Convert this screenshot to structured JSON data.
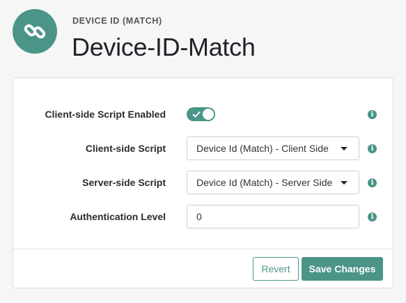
{
  "header": {
    "icon": "chain-link-icon",
    "subtitle": "DEVICE ID (MATCH)",
    "title": "Device-ID-Match"
  },
  "form": {
    "client_script_enabled": {
      "label": "Client-side Script Enabled",
      "value": true
    },
    "client_script": {
      "label": "Client-side Script",
      "value": "Device Id (Match) - Client Side"
    },
    "server_script": {
      "label": "Server-side Script",
      "value": "Device Id (Match) - Server Side"
    },
    "auth_level": {
      "label": "Authentication Level",
      "value": "0"
    },
    "info_glyph": "i"
  },
  "footer": {
    "revert_label": "Revert",
    "save_label": "Save Changes"
  },
  "colors": {
    "accent": "#4a9587",
    "background": "#f6f6f7"
  }
}
